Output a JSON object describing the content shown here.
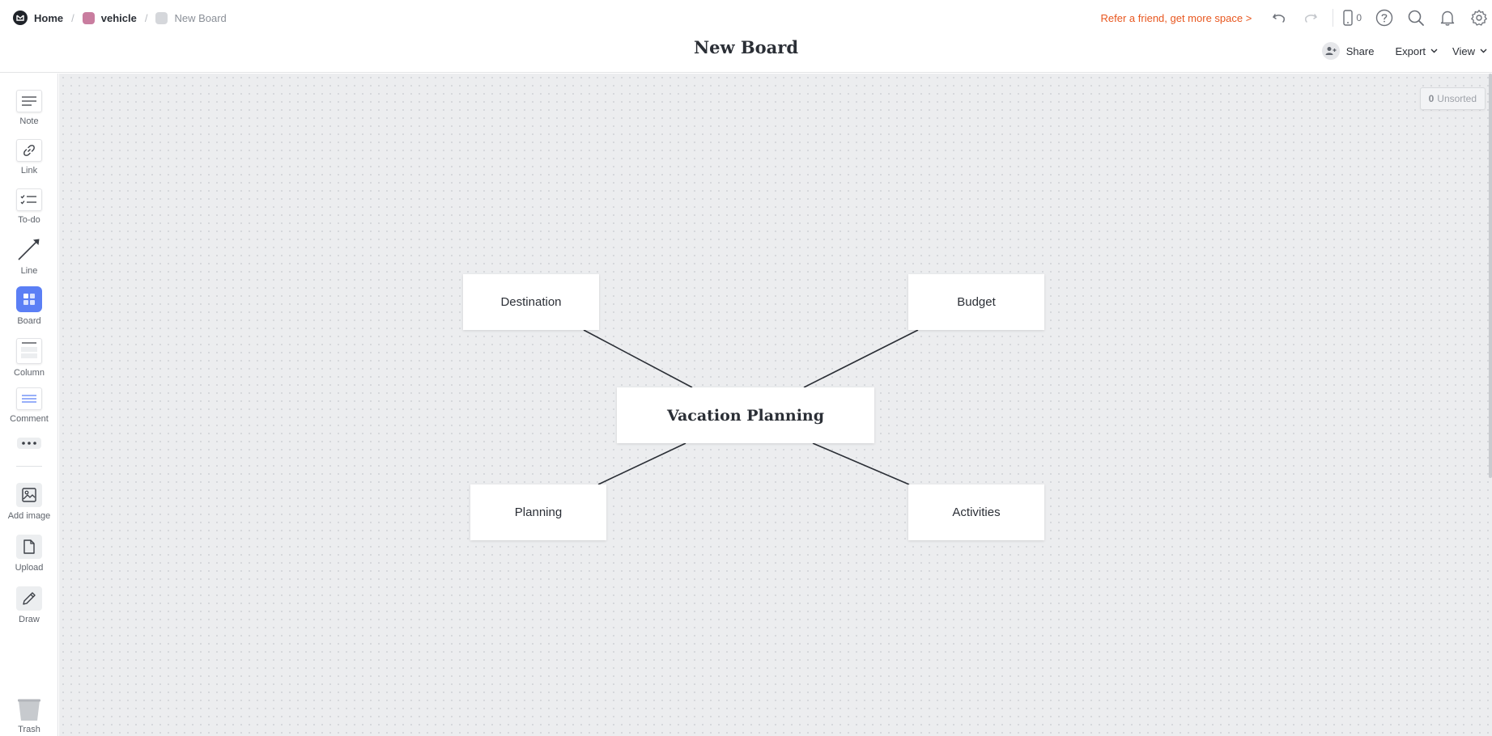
{
  "breadcrumb": {
    "home": "Home",
    "workspace": "vehicle",
    "workspace_color": "#c97d9f",
    "board": "New Board",
    "board_color": "#d5d7db"
  },
  "header": {
    "title": "New Board",
    "refer_link": "Refer a friend, get more space >",
    "refer_color": "#e8571f",
    "device_count": "0",
    "share": "Share",
    "export": "Export",
    "view": "View"
  },
  "toolbar": {
    "items": [
      {
        "label": "Note",
        "icon": "note-icon"
      },
      {
        "label": "Link",
        "icon": "link-icon"
      },
      {
        "label": "To-do",
        "icon": "todo-icon"
      },
      {
        "label": "Line",
        "icon": "line-icon"
      },
      {
        "label": "Board",
        "icon": "board-icon"
      },
      {
        "label": "Column",
        "icon": "column-icon"
      },
      {
        "label": "Comment",
        "icon": "comment-icon"
      },
      {
        "label": "",
        "icon": "more-icon"
      },
      {
        "label": "Add image",
        "icon": "image-icon"
      },
      {
        "label": "Upload",
        "icon": "upload-icon"
      },
      {
        "label": "Draw",
        "icon": "pencil-icon"
      },
      {
        "label": "Trash",
        "icon": "trash-icon"
      }
    ],
    "accent_color": "#5b7ff5"
  },
  "canvas": {
    "unsorted_count": "0",
    "unsorted_label": "Unsorted",
    "cards": {
      "center": "Vacation Planning",
      "destination": "Destination",
      "budget": "Budget",
      "planning": "Planning",
      "activities": "Activities"
    }
  }
}
